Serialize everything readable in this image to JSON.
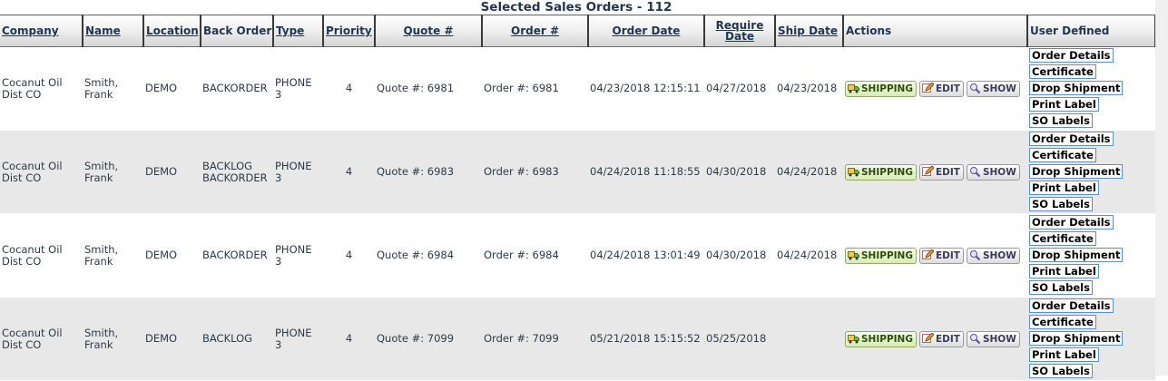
{
  "page_title": "Selected Sales Orders - 112",
  "columns": {
    "company": "Company",
    "name": "Name",
    "location": "Location",
    "back_order": "Back Order",
    "type": "Type",
    "priority": "Priority",
    "quote": "Quote #",
    "order": "Order #",
    "order_date": "Order Date",
    "require_date": "Require Date",
    "ship_date": "Ship Date",
    "actions": "Actions",
    "user_defined": "User Defined"
  },
  "buttons": {
    "shipping": "SHIPPING",
    "edit": "EDIT",
    "show": "SHOW"
  },
  "user_defined_links": [
    "Order Details",
    "Certificate",
    "Drop Shipment",
    "Print Label",
    "SO Labels"
  ],
  "rows": [
    {
      "company": "Cocanut Oil Dist CO",
      "name": "Smith, Frank",
      "location": "DEMO",
      "back_order": "BACKORDER",
      "type": "PHONE 3",
      "priority": "4",
      "quote": "Quote #: 6981",
      "order": "Order #: 6981",
      "order_date": "04/23/2018 12:15:11",
      "require_date": "04/27/2018",
      "ship_date": "04/23/2018"
    },
    {
      "company": "Cocanut Oil Dist CO",
      "name": "Smith, Frank",
      "location": "DEMO",
      "back_order": "BACKLOG BACKORDER",
      "type": "PHONE 3",
      "priority": "4",
      "quote": "Quote #: 6983",
      "order": "Order #: 6983",
      "order_date": "04/24/2018 11:18:55",
      "require_date": "04/30/2018",
      "ship_date": "04/24/2018"
    },
    {
      "company": "Cocanut Oil Dist CO",
      "name": "Smith, Frank",
      "location": "DEMO",
      "back_order": "BACKORDER",
      "type": "PHONE 3",
      "priority": "4",
      "quote": "Quote #: 6984",
      "order": "Order #: 6984",
      "order_date": "04/24/2018 13:01:49",
      "require_date": "04/30/2018",
      "ship_date": "04/24/2018"
    },
    {
      "company": "Cocanut Oil Dist CO",
      "name": "Smith, Frank",
      "location": "DEMO",
      "back_order": "BACKLOG",
      "type": "PHONE 3",
      "priority": "4",
      "quote": "Quote #: 7099",
      "order": "Order #: 7099",
      "order_date": "05/21/2018 15:15:52",
      "require_date": "05/25/2018",
      "ship_date": ""
    }
  ]
}
